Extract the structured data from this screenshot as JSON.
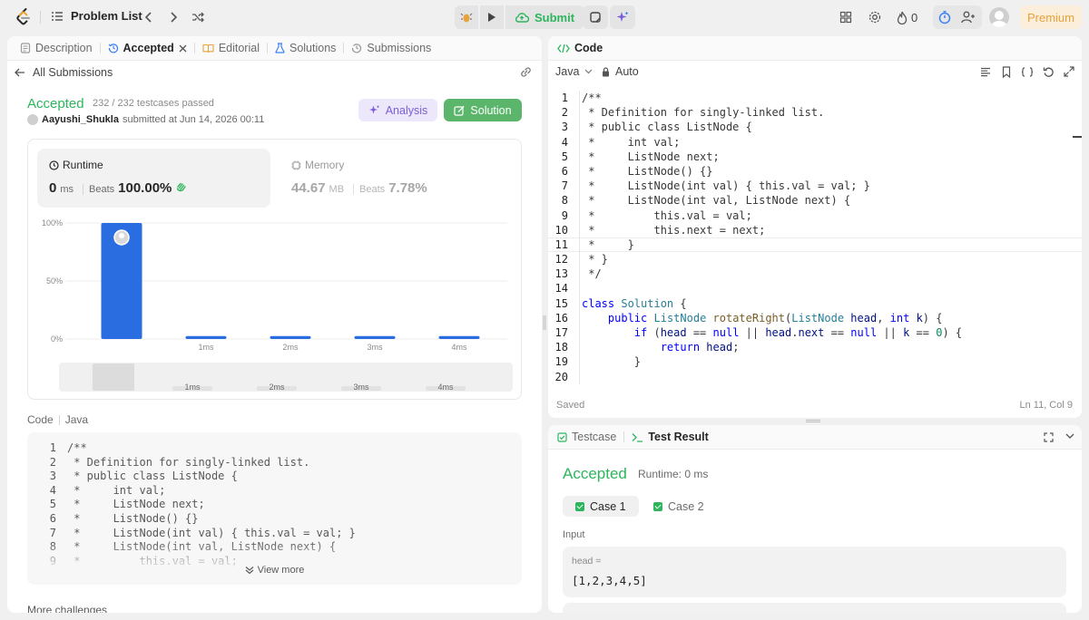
{
  "topbar": {
    "title": "Problem List",
    "submit_label": "Submit",
    "fire_count": "0",
    "premium_label": "Premium"
  },
  "left": {
    "tabs": [
      "Description",
      "Accepted",
      "Editorial",
      "Solutions",
      "Submissions"
    ],
    "back_label": "All Submissions",
    "status": "Accepted",
    "testcases": "232 / 232 testcases passed",
    "submitter_name": "Aayushi_Shukla",
    "submitted_text": "submitted at Jun 14, 2026 00:11",
    "analysis_label": "Analysis",
    "solution_label": "Solution",
    "runtime": {
      "label": "Runtime",
      "value": "0",
      "unit": "ms",
      "beats_label": "Beats",
      "beats": "100.00%"
    },
    "memory": {
      "label": "Memory",
      "value": "44.67",
      "unit": "MB",
      "beats_label": "Beats",
      "beats": "7.78%"
    },
    "code_label": "Code",
    "code_lang": "Java",
    "view_more": "View more",
    "more_challenges": "More challenges",
    "preview_lines": [
      {
        "n": "1",
        "t": "/**"
      },
      {
        "n": "2",
        "t": " * Definition for singly-linked list."
      },
      {
        "n": "3",
        "t": " * public class ListNode {"
      },
      {
        "n": "4",
        "t": " *     int val;"
      },
      {
        "n": "5",
        "t": " *     ListNode next;"
      },
      {
        "n": "6",
        "t": " *     ListNode() {}"
      },
      {
        "n": "7",
        "t": " *     ListNode(int val) { this.val = val; }"
      },
      {
        "n": "8",
        "t": " *     ListNode(int val, ListNode next) {"
      },
      {
        "n": "9",
        "t": " *         this.val = val;"
      }
    ]
  },
  "chart_data": {
    "type": "bar",
    "categories": [
      "0ms",
      "1ms",
      "2ms",
      "3ms",
      "4ms"
    ],
    "x_tick_labels": [
      "",
      "1ms",
      "2ms",
      "3ms",
      "4ms"
    ],
    "values": [
      100,
      2.5,
      2.5,
      2.5,
      2.5
    ],
    "y_ticks": [
      "100%",
      "50%",
      "0%"
    ],
    "ylim": [
      0,
      100
    ],
    "highlight_index": 0,
    "bar_color": "#2a6de0",
    "overview_labels": [
      "1ms",
      "2ms",
      "3ms",
      "4ms"
    ]
  },
  "editor": {
    "title": "Code",
    "lang": "Java",
    "mode": "Auto",
    "saved": "Saved",
    "cursor": "Ln 11, Col 9"
  },
  "test": {
    "tab_testcase": "Testcase",
    "tab_result": "Test Result",
    "status": "Accepted",
    "runtime": "Runtime: 0 ms",
    "case1": "Case 1",
    "case2": "Case 2",
    "input_label": "Input",
    "var_name": "head =",
    "var_value": "[1,2,3,4,5]"
  },
  "colors": {
    "accepted": "#2db55d",
    "premium_text": "#e8a23b",
    "solution_btn": "#5bb56b",
    "analysis_text": "#7c5cdb"
  }
}
